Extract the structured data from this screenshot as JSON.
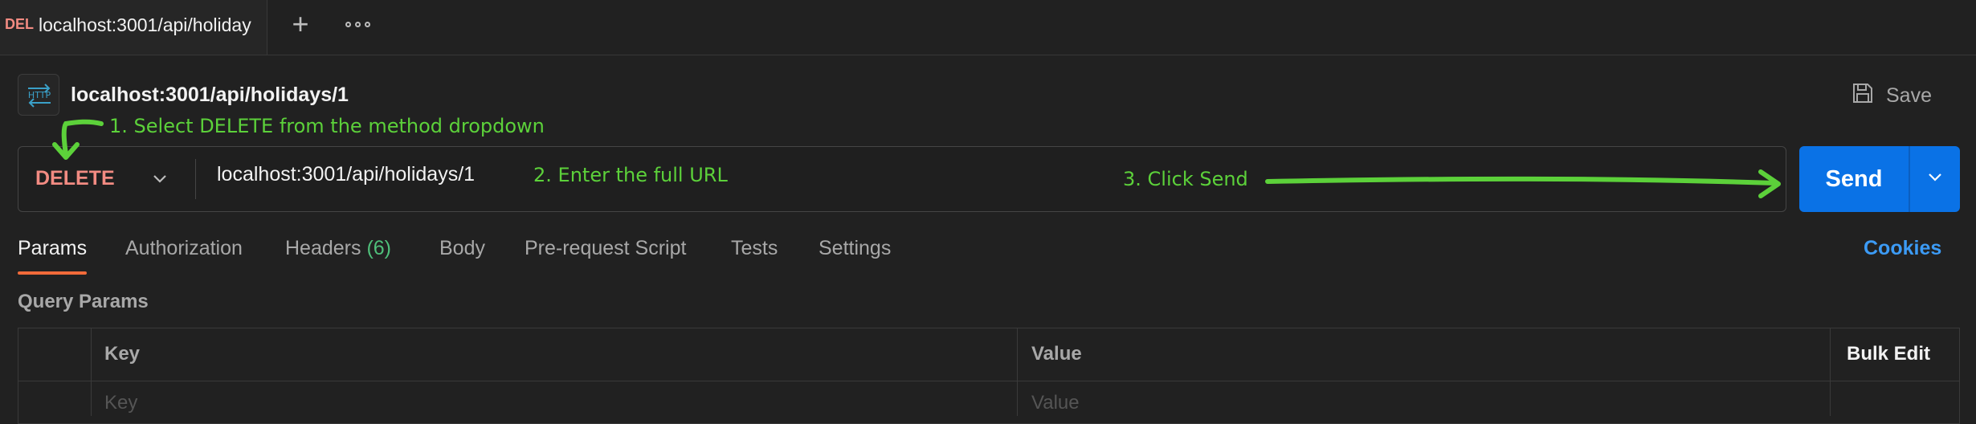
{
  "tab": {
    "method_badge": "DEL",
    "title": "localhost:3001/api/holiday",
    "new_tab_icon": "plus-icon",
    "more_icon": "ellipsis-icon"
  },
  "request": {
    "icon": "http-icon",
    "icon_text": "HTTP",
    "title": "localhost:3001/api/holidays/1",
    "save_label": "Save",
    "save_icon": "floppy-disk-icon"
  },
  "url_bar": {
    "method": "DELETE",
    "url": "localhost:3001/api/holidays/1",
    "send_label": "Send"
  },
  "sub_tabs": [
    {
      "label": "Params",
      "active": true
    },
    {
      "label": "Authorization"
    },
    {
      "label": "Headers",
      "count": "(6)"
    },
    {
      "label": "Body"
    },
    {
      "label": "Pre-request Script"
    },
    {
      "label": "Tests"
    },
    {
      "label": "Settings"
    }
  ],
  "cookies_label": "Cookies",
  "query_params": {
    "section_title": "Query Params",
    "headers": {
      "key": "Key",
      "value": "Value",
      "bulk_edit": "Bulk Edit"
    },
    "placeholders": {
      "key": "Key",
      "value": "Value"
    }
  },
  "annotations": {
    "step1": "1. Select DELETE from the method dropdown",
    "step2": "2. Enter the full URL",
    "step3": "3. Click Send"
  },
  "colors": {
    "method": "#f28b82",
    "send_button": "#0a72e6",
    "annotation": "#5cd13a",
    "active_tab_underline": "#f26b3a",
    "cookies_link": "#3c9bf5",
    "headers_count": "#4fbf7a"
  }
}
